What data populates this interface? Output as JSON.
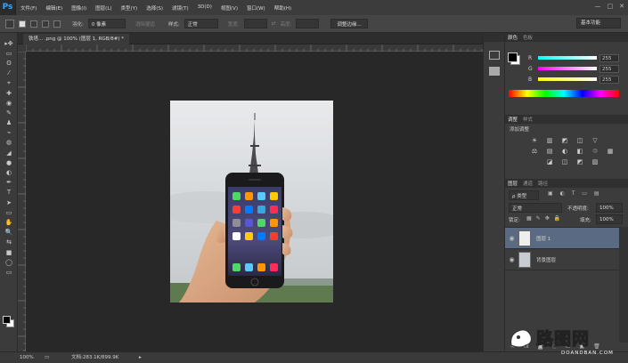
{
  "app": {
    "logo": "Ps"
  },
  "menu": [
    "文件(F)",
    "编辑(E)",
    "图像(I)",
    "图层(L)",
    "类型(Y)",
    "选择(S)",
    "滤镜(T)",
    "3D(D)",
    "视图(V)",
    "窗口(W)",
    "帮助(H)"
  ],
  "window_controls": [
    "—",
    "□",
    "✕"
  ],
  "options": {
    "feather_label": "羽化:",
    "feather_value": "0 像素",
    "antialias_label": "消除锯齿",
    "style_label": "样式:",
    "style_value": "正常",
    "width_label": "宽度:",
    "height_label": "高度:",
    "refine_edge": "调整边缘...",
    "workspace": "基本功能"
  },
  "document": {
    "tab_title": "铁塔... .png @ 100% (图层 1, RGB/8#) *"
  },
  "status": {
    "zoom": "100%",
    "doc_info": "文档:283.1K/899.9K"
  },
  "color_panel": {
    "tabs": [
      "颜色",
      "色板"
    ],
    "rows": [
      {
        "label": "R",
        "value": "255",
        "gradient": "linear-gradient(to right,#00ffff,#ffffff)"
      },
      {
        "label": "G",
        "value": "255",
        "gradient": "linear-gradient(to right,#ff00ff,#ffffff)"
      },
      {
        "label": "B",
        "value": "255",
        "gradient": "linear-gradient(to right,#ffff00,#ffffff)"
      }
    ]
  },
  "adjustments_panel": {
    "tabs": [
      "调整",
      "样式"
    ],
    "title": "添加调整",
    "icons": [
      "☀",
      "▥",
      "◩",
      "◫",
      "▽",
      "",
      "⚖",
      "▤",
      "◐",
      "◧",
      "♲",
      "▦",
      "",
      "◪",
      "◫",
      "◩",
      "▨",
      ""
    ]
  },
  "layers_panel": {
    "tabs": [
      "图层",
      "通道",
      "路径"
    ],
    "filter_label": "ρ 类型",
    "blend_mode": "正常",
    "opacity_label": "不透明度:",
    "opacity_value": "100%",
    "lock_label": "锁定:",
    "fill_label": "填充:",
    "fill_value": "100%",
    "layers": [
      {
        "name": "图层 1",
        "selected": true
      },
      {
        "name": "背景图层",
        "selected": false
      }
    ],
    "bottom_icons": [
      "∞",
      "fx",
      "◙",
      "◌",
      "▭",
      "▣",
      "🗑"
    ]
  },
  "watermark": {
    "site": "路图网",
    "url": "DOANDBAN.COM"
  },
  "tools": [
    "▸✥",
    "▭",
    "ʘ",
    "⁄",
    "⌖",
    "✚",
    "◉",
    "✎",
    "♟",
    "⌁",
    "◍",
    "◢",
    "●",
    "◐",
    "✒",
    "T",
    "➤",
    "▭",
    "✋",
    "🔍",
    "⇆",
    "■",
    "◯",
    "▭"
  ],
  "colors": {
    "accent": "#31a8ff",
    "selected_layer": "#5a6a82",
    "panel_bg": "#3c3c3c"
  }
}
